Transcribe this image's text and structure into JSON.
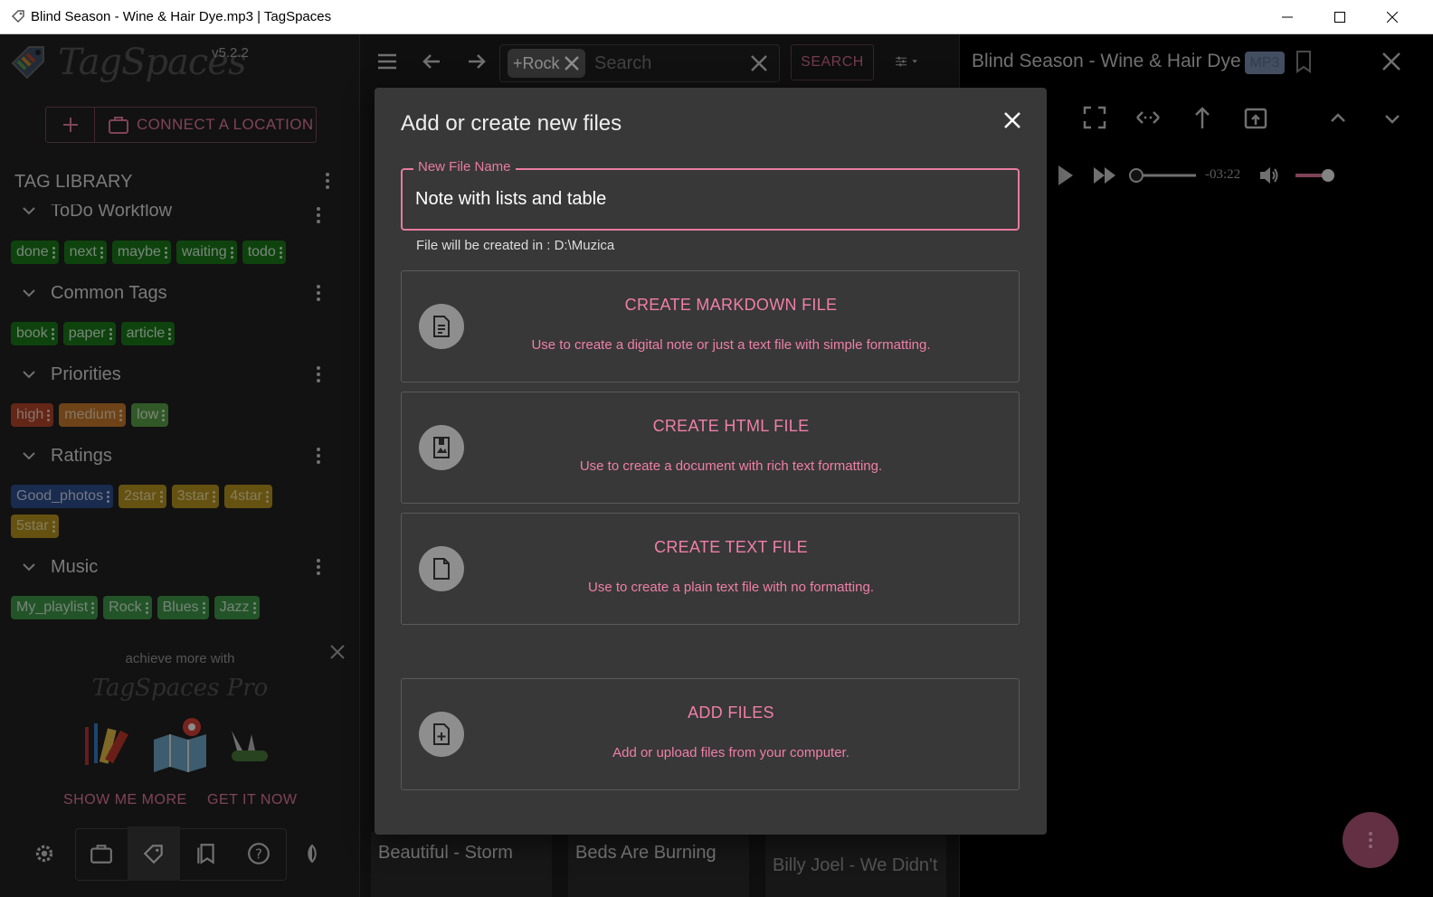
{
  "window": {
    "title": "Blind Season - Wine & Hair Dye.mp3 | TagSpaces"
  },
  "sidebar": {
    "version": "v5.2.2",
    "logo_text": "TagSpaces",
    "connect_label": "CONNECT A LOCATION",
    "tag_library_title": "TAG LIBRARY",
    "groups": [
      {
        "name": "ToDo Workflow",
        "tags": [
          {
            "label": "done",
            "color": "#1b7a1b",
            "text": "#d9f5d9"
          },
          {
            "label": "next",
            "color": "#1b7a1b",
            "text": "#d9f5d9"
          },
          {
            "label": "maybe",
            "color": "#1b7a1b",
            "text": "#d9f5d9"
          },
          {
            "label": "waiting",
            "color": "#1b7a1b",
            "text": "#d9f5d9"
          },
          {
            "label": "todo",
            "color": "#1b7a1b",
            "text": "#d9f5d9"
          }
        ]
      },
      {
        "name": "Common Tags",
        "tags": [
          {
            "label": "book",
            "color": "#1b7a1b",
            "text": "#d9f5d9"
          },
          {
            "label": "paper",
            "color": "#1b7a1b",
            "text": "#d9f5d9"
          },
          {
            "label": "article",
            "color": "#1b7a1b",
            "text": "#d9f5d9"
          }
        ]
      },
      {
        "name": "Priorities",
        "tags": [
          {
            "label": "high",
            "color": "#b5462a",
            "text": "#f7d2c6"
          },
          {
            "label": "medium",
            "color": "#c87a2a",
            "text": "#f3d9b8"
          },
          {
            "label": "low",
            "color": "#5aa34a",
            "text": "#def3d5"
          }
        ]
      },
      {
        "name": "Ratings",
        "tags": [
          {
            "label": "Good_photos",
            "color": "#2f4f8f",
            "text": "#cfdaf0"
          },
          {
            "label": "2star",
            "color": "#b8961f",
            "text": "#f3e2a8"
          },
          {
            "label": "3star",
            "color": "#b8961f",
            "text": "#f3e2a8"
          },
          {
            "label": "4star",
            "color": "#b8961f",
            "text": "#f3e2a8"
          },
          {
            "label": "5star",
            "color": "#b8961f",
            "text": "#f3e2a8"
          }
        ]
      },
      {
        "name": "Music",
        "tags": [
          {
            "label": "My_playlist",
            "color": "#3f9a4a",
            "text": "#d8f0d9"
          },
          {
            "label": "Rock",
            "color": "#3f9a4a",
            "text": "#d8f0d9"
          },
          {
            "label": "Blues",
            "color": "#3f9a4a",
            "text": "#d8f0d9"
          },
          {
            "label": "Jazz",
            "color": "#3f9a4a",
            "text": "#d8f0d9"
          }
        ]
      }
    ],
    "pro": {
      "label": "achieve more with",
      "logo": "TagSpaces Pro",
      "show_more": "SHOW ME MORE",
      "get_it": "GET IT NOW"
    }
  },
  "toolbar": {
    "search_chip": "+Rock",
    "search_placeholder": "Search",
    "search_button": "SEARCH"
  },
  "grid": {
    "cards": [
      "Beautiful - Storm",
      "Beds Are Burning",
      "Billy Joel - We Didn't"
    ]
  },
  "viewer": {
    "title": "Blind Season - Wine & Hair Dye",
    "badge": "MP3",
    "time": "-03:22"
  },
  "dialog": {
    "title": "Add or create new files",
    "field_label": "New File Name",
    "field_value": "Note with lists and table",
    "location_hint": "File will be created in : D:\\Muzica",
    "options": [
      {
        "title": "CREATE MARKDOWN FILE",
        "desc": "Use to create a digital note or just a text file with simple formatting.",
        "icon": "markdown-file-icon"
      },
      {
        "title": "CREATE HTML FILE",
        "desc": "Use to create a document with rich text formatting.",
        "icon": "html-file-icon"
      },
      {
        "title": "CREATE TEXT FILE",
        "desc": "Use to create a plain text file with no formatting.",
        "icon": "text-file-icon"
      },
      {
        "title": "ADD FILES",
        "desc": "Add or upload files from your computer.",
        "icon": "add-file-icon"
      }
    ]
  },
  "colors": {
    "accent": "#e77ba0",
    "dialog_bg": "#383838",
    "sidebar_bg": "#212121"
  }
}
